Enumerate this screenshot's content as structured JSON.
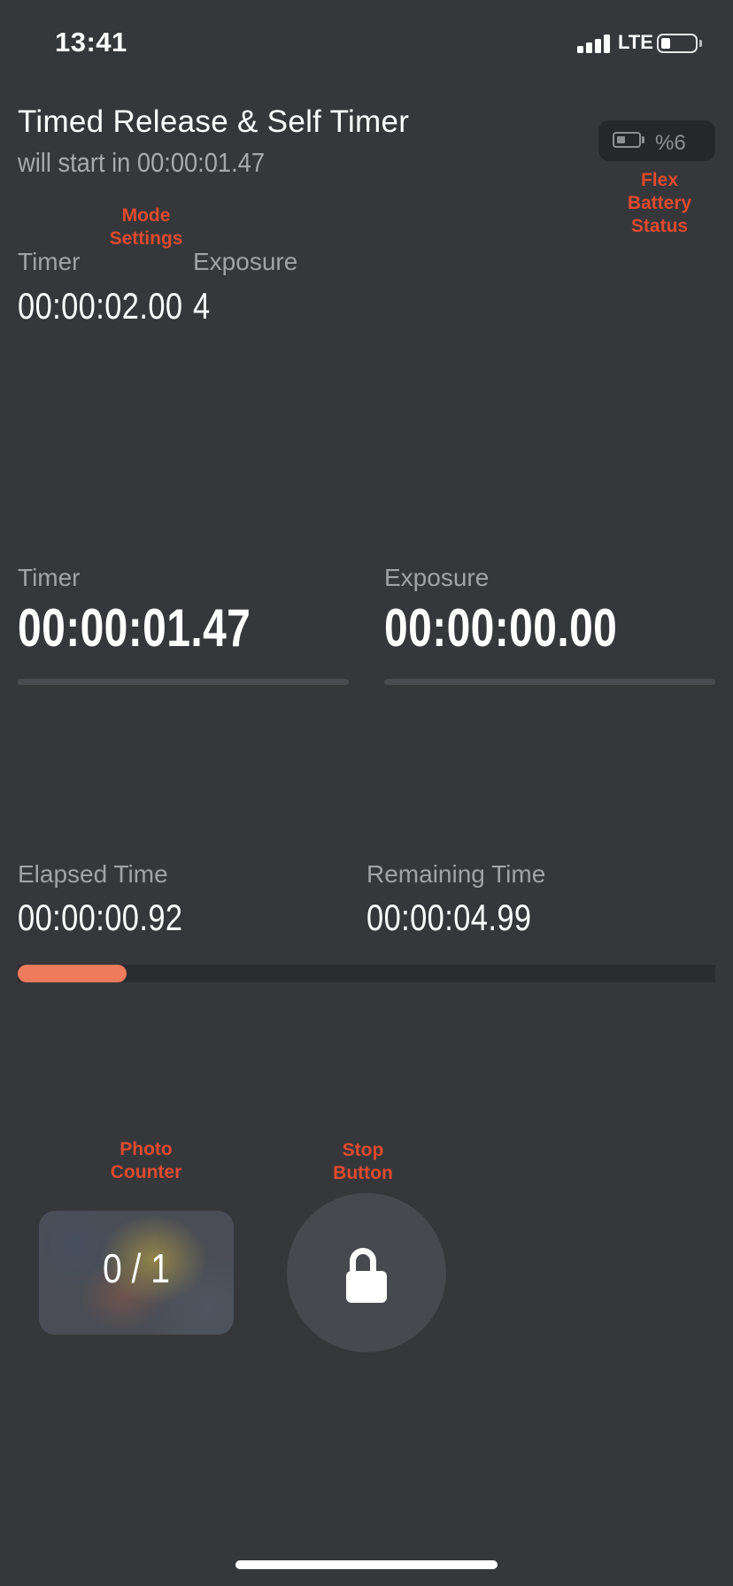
{
  "status_bar": {
    "time": "13:41",
    "network": "LTE"
  },
  "header": {
    "title": "Timed Release & Self Timer",
    "subtitle": "will start in 00:00:01.47"
  },
  "flex_battery": {
    "percent": "%6"
  },
  "annotations": {
    "flex_battery": [
      "Flex",
      "Battery",
      "Status"
    ],
    "mode_settings": [
      "Mode",
      "Settings"
    ],
    "photo_counter": [
      "Photo",
      "Counter"
    ],
    "stop_button": [
      "Stop",
      "Button"
    ]
  },
  "mode_settings": {
    "timer_label": "Timer",
    "timer_value": "00:00:02.00",
    "exposure_label": "Exposure",
    "exposure_value": "4"
  },
  "countdowns": {
    "timer_label": "Timer",
    "timer_value": "00:00:01.47",
    "exposure_label": "Exposure",
    "exposure_value": "00:00:00.00"
  },
  "progress": {
    "elapsed_label": "Elapsed Time",
    "elapsed_value": "00:00:00.92",
    "remaining_label": "Remaining Time",
    "remaining_value": "00:00:04.99",
    "fraction": 0.156
  },
  "photo_counter": {
    "value": "0 / 1"
  },
  "colors": {
    "background": "#36373b",
    "accent": "#ee7b5c",
    "annotation": "#e14a2e"
  },
  "icons": {
    "stop": "lock-icon",
    "flex_battery": "battery-icon"
  }
}
